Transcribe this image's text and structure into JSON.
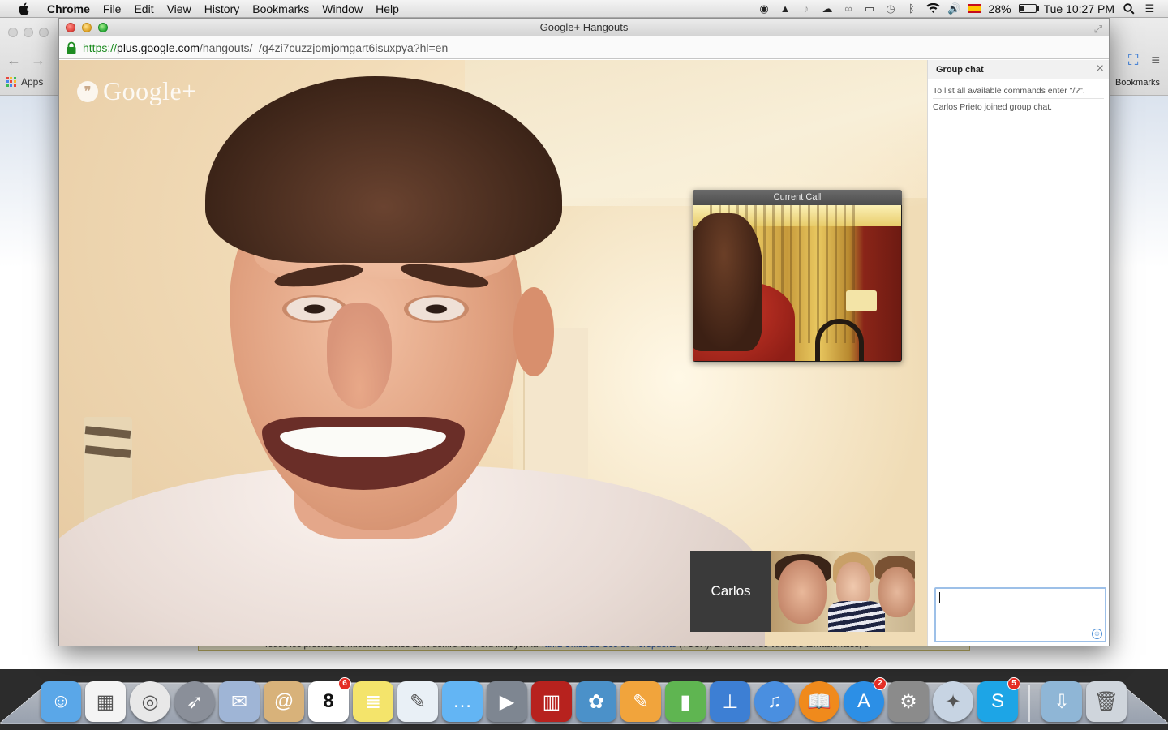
{
  "menubar": {
    "app_name": "Chrome",
    "menus": [
      "File",
      "Edit",
      "View",
      "History",
      "Bookmarks",
      "Window",
      "Help"
    ],
    "status_icons": [
      "evernote-icon",
      "drive-icon",
      "notification-icon",
      "cloud-icon",
      "creative-cloud-icon",
      "airplay-icon",
      "time-machine-icon",
      "bluetooth-icon",
      "wifi-icon",
      "volume-icon",
      "spain-flag-icon"
    ],
    "battery_percent": "28%",
    "battery_level": 0.28,
    "clock": "Tue 10:27 PM"
  },
  "background_browser": {
    "apps_label": "Apps",
    "bookmarks_label": "Bookmarks",
    "banner_text": "Todos los precios de nuestros vuelos LAN dentro del Perú incluyen la ",
    "banner_link": "Tarifa Única de Uso de Aeropuerto",
    "banner_tail": " (TUUA). En el caso de vuelos internacionales, el"
  },
  "hangout_window": {
    "title": "Google+ Hangouts",
    "url_scheme": "https://",
    "url_host": "plus.google.com",
    "url_path": "/hangouts/_/g4zi7cuzzjomjomgart6isuxpya?hl=en",
    "logo_text": "Google+",
    "current_call_label": "Current Call",
    "participant_name": "Carlos",
    "chat": {
      "title": "Group chat",
      "close_label": "×",
      "messages": [
        "To list all available commands enter \"/?\".",
        "Carlos Prieto joined group chat."
      ],
      "input_value": ""
    }
  },
  "dock": {
    "apps": [
      {
        "name": "finder",
        "color": "#5aa7e8"
      },
      {
        "name": "launchpad-grid",
        "color": "#f4f4f4"
      },
      {
        "name": "chrome",
        "color": "#e8e8e8"
      },
      {
        "name": "rocket",
        "color": "#8a8f99"
      },
      {
        "name": "preview-stamp",
        "color": "#9fb5d6"
      },
      {
        "name": "contacts",
        "color": "#d8b27a"
      },
      {
        "name": "calendar",
        "color": "#ffffff",
        "badge": "6",
        "label": "8"
      },
      {
        "name": "stickies",
        "color": "#f4e46b"
      },
      {
        "name": "maps",
        "color": "#e9f0f6"
      },
      {
        "name": "messages",
        "color": "#63b5f4"
      },
      {
        "name": "facetime",
        "color": "#7e8691"
      },
      {
        "name": "photo-booth",
        "color": "#b7221e"
      },
      {
        "name": "iphoto",
        "color": "#4b91c9"
      },
      {
        "name": "pages",
        "color": "#f1a43c"
      },
      {
        "name": "numbers",
        "color": "#5fb551"
      },
      {
        "name": "keynote",
        "color": "#3d7fd4"
      },
      {
        "name": "itunes",
        "color": "#4a8fe0"
      },
      {
        "name": "ibooks",
        "color": "#f08a1c"
      },
      {
        "name": "app-store",
        "color": "#2c8fe6",
        "badge": "2"
      },
      {
        "name": "system-preferences",
        "color": "#8b8b8b"
      },
      {
        "name": "safari",
        "color": "#c7d4e3"
      },
      {
        "name": "skype",
        "color": "#1da5e6",
        "badge": "5"
      },
      {
        "name": "downloads-folder",
        "color": "#8fb6d6"
      },
      {
        "name": "trash",
        "color": "#cfd5dc"
      }
    ]
  }
}
